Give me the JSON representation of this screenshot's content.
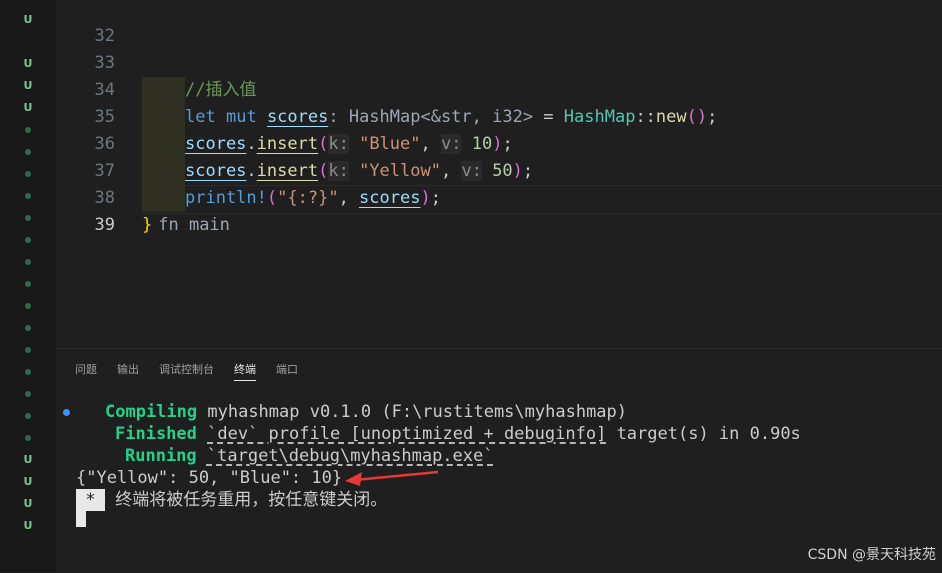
{
  "gutter_marks": [
    "U",
    "",
    "U",
    "U",
    "U",
    "dot",
    "dot",
    "dot",
    "dot",
    "dot",
    "dot",
    "dot",
    "dot",
    "dot",
    "dot",
    "dot",
    "dot",
    "dot",
    "dot",
    "dot",
    "U",
    "U",
    "U",
    "U"
  ],
  "editor": {
    "line_numbers": [
      "32",
      "33",
      "34",
      "35",
      "36",
      "37",
      "38",
      "39"
    ],
    "active_line": "39",
    "comment": "//插入值",
    "l34": {
      "let": "let",
      "mut": "mut",
      "var": "scores",
      "hint": ": HashMap<&str, i32>",
      "eq": " = ",
      "type": "HashMap",
      "sep": "::",
      "fn": "new",
      "open": "(",
      "close": ")",
      "end": ";"
    },
    "l35": {
      "var": "scores",
      "dot": ".",
      "fn": "insert",
      "open": "(",
      "khint": "k:",
      "str": "\"Blue\"",
      "comma": ", ",
      "vhint": "v:",
      "num": "10",
      "close": ")",
      "end": ";"
    },
    "l36": {
      "var": "scores",
      "dot": ".",
      "fn": "insert",
      "open": "(",
      "khint": "k:",
      "str": "\"Yellow\"",
      "comma": ", ",
      "vhint": "v:",
      "num": "50",
      "close": ")",
      "end": ";"
    },
    "l37": {
      "mac": "println!",
      "open": "(",
      "str": "\"{:?}\"",
      "comma": ", ",
      "var": "scores",
      "close": ")",
      "end": ";"
    },
    "l38": {
      "brace": "}",
      "hint": "fn main"
    }
  },
  "panel": {
    "tabs": [
      "问题",
      "输出",
      "调试控制台",
      "终端",
      "端口"
    ],
    "active_tab": "终端"
  },
  "terminal": {
    "compiling_kw": "Compiling",
    "compiling_txt": "myhashmap v0.1.0 (F:\\rustitems\\myhashmap)",
    "finished_kw": "Finished",
    "finished_txt": "`dev` profile [unoptimized + debuginfo]",
    "finished_tail": "target(s) in 0.90s",
    "running_kw": "Running",
    "running_txt": "`target\\debug\\myhashmap.exe`",
    "output": "{\"Yellow\": 50, \"Blue\": 10}",
    "star": "*",
    "close_msg": "终端将被任务重用，按任意键关闭。"
  },
  "watermark": "CSDN @景天科技苑",
  "colors": {
    "arrow": "#e53935",
    "success_green": "#23d18b",
    "accent_blue": "#3794ff"
  }
}
